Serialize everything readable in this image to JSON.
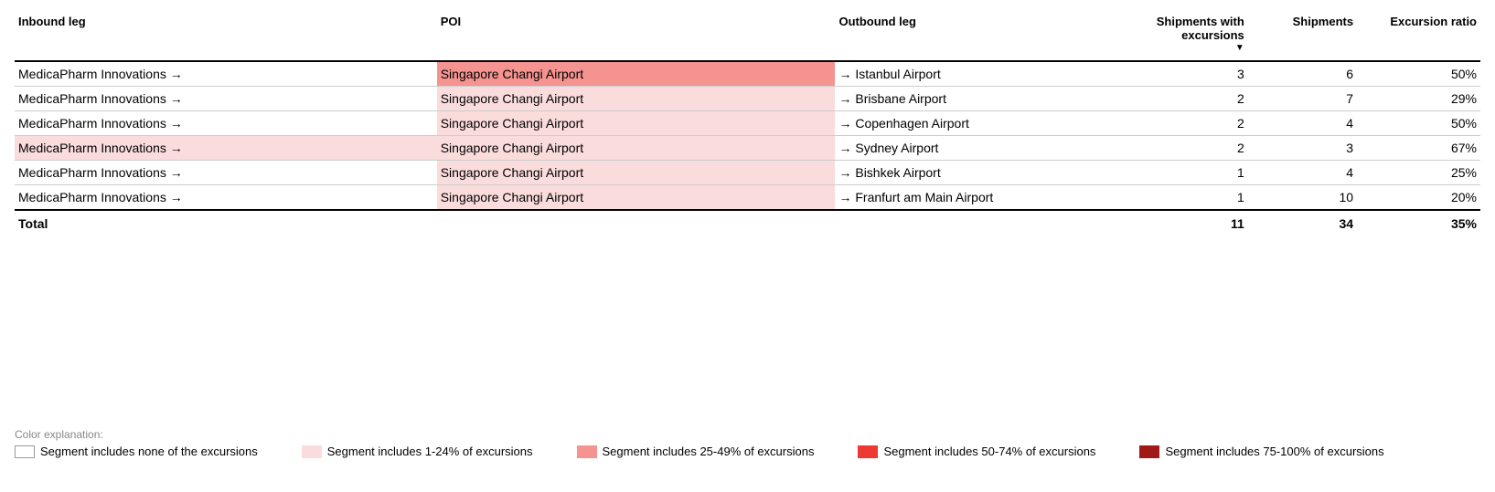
{
  "headers": {
    "inbound": "Inbound leg",
    "poi": "POI",
    "outbound": "Outbound leg",
    "shipments_with_excursions": "Shipments with excursions",
    "shipments": "Shipments",
    "excursion_ratio": "Excursion ratio"
  },
  "rows": [
    {
      "inbound": "MedicaPharm Innovations →",
      "inbound_heat": "heat-none",
      "poi": "Singapore Changi Airport",
      "poi_heat": "heat-2",
      "outbound": "→ Istanbul Airport",
      "outbound_heat": "heat-none",
      "swe": "3",
      "shipments": "6",
      "ratio": "50%"
    },
    {
      "inbound": "MedicaPharm Innovations →",
      "inbound_heat": "heat-none",
      "poi": "Singapore Changi Airport",
      "poi_heat": "heat-1",
      "outbound": "→ Brisbane Airport",
      "outbound_heat": "heat-none",
      "swe": "2",
      "shipments": "7",
      "ratio": "29%"
    },
    {
      "inbound": "MedicaPharm Innovations →",
      "inbound_heat": "heat-none",
      "poi": "Singapore Changi Airport",
      "poi_heat": "heat-1",
      "outbound": "→ Copenhagen Airport",
      "outbound_heat": "heat-none",
      "swe": "2",
      "shipments": "4",
      "ratio": "50%"
    },
    {
      "inbound": "MedicaPharm Innovations →",
      "inbound_heat": "heat-1",
      "poi": "Singapore Changi Airport",
      "poi_heat": "heat-1",
      "outbound": "→ Sydney Airport",
      "outbound_heat": "heat-none",
      "swe": "2",
      "shipments": "3",
      "ratio": "67%"
    },
    {
      "inbound": "MedicaPharm Innovations →",
      "inbound_heat": "heat-none",
      "poi": "Singapore Changi Airport",
      "poi_heat": "heat-1",
      "outbound": "→ Bishkek Airport",
      "outbound_heat": "heat-none",
      "swe": "1",
      "shipments": "4",
      "ratio": "25%"
    },
    {
      "inbound": "MedicaPharm Innovations →",
      "inbound_heat": "heat-none",
      "poi": "Singapore Changi Airport",
      "poi_heat": "heat-1",
      "outbound": "→ Franfurt am Main Airport",
      "outbound_heat": "heat-none",
      "swe": "1",
      "shipments": "10",
      "ratio": "20%"
    }
  ],
  "totals": {
    "label": "Total",
    "swe": "11",
    "shipments": "34",
    "ratio": "35%"
  },
  "legend": {
    "title": "Color explanation:",
    "items": [
      {
        "label": "Segment includes none of the excursions",
        "swatch": "heat-none",
        "border": true
      },
      {
        "label": "Segment includes 1-24% of excursions",
        "swatch": "heat-1",
        "border": false
      },
      {
        "label": "Segment includes 25-49% of excursions",
        "swatch": "heat-2",
        "border": false
      },
      {
        "label": "Segment includes 50-74% of excursions",
        "swatch": "heat-3",
        "border": false
      },
      {
        "label": "Segment includes 75-100% of excursions",
        "swatch": "heat-4",
        "border": false
      }
    ]
  }
}
